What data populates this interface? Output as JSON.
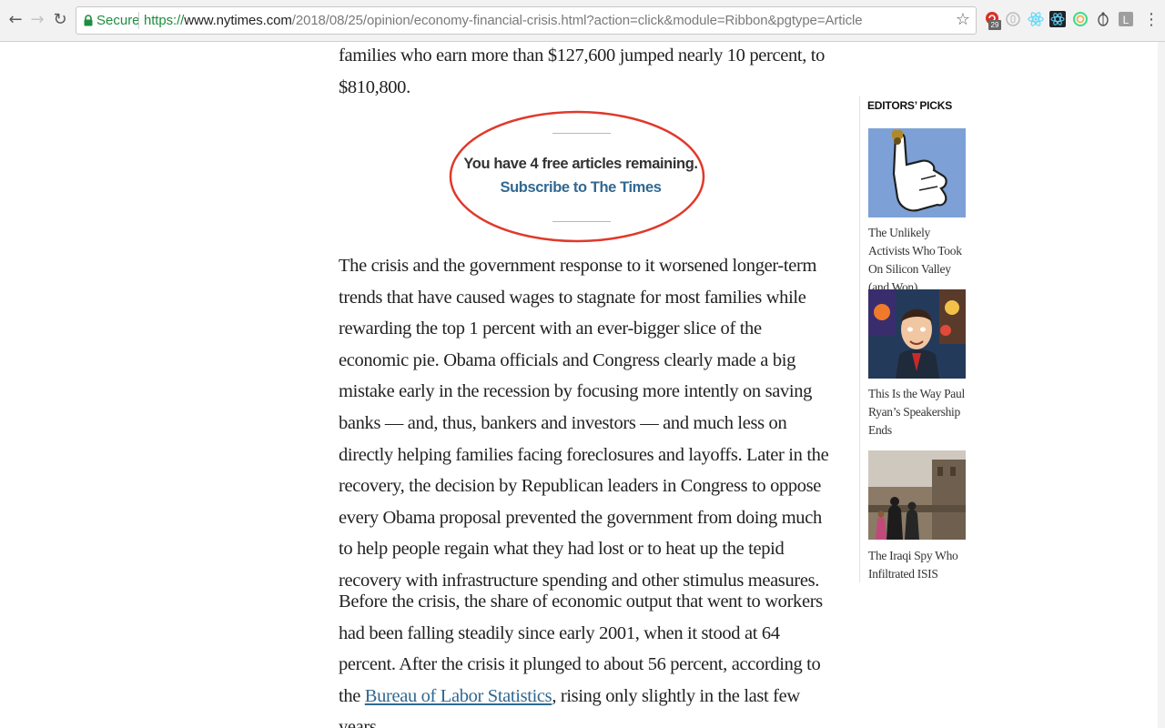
{
  "browser": {
    "secure_label": "Secure",
    "url": {
      "scheme": "https://",
      "host": "www.nytimes.com",
      "path": "/2018/08/25/opinion/economy-financial-crisis.html?action=click&module=Ribbon&pgtype=Article"
    },
    "extensions": [
      {
        "icon": "notification-extension-icon",
        "badge": "29",
        "color": "#d93025"
      },
      {
        "icon": "circle-extension-icon",
        "color": "#bbbbbb"
      },
      {
        "icon": "react-devtools-icon",
        "color": "#61dafb"
      },
      {
        "icon": "react-dark-extension-icon",
        "color": "#61dafb"
      },
      {
        "icon": "green-ring-extension-icon",
        "color": "#3ddc84"
      },
      {
        "icon": "bug-extension-icon",
        "color": "#555555"
      },
      {
        "icon": "letter-l-extension-icon",
        "letter": "L",
        "color": "#9e9e9e"
      }
    ]
  },
  "article": {
    "paragraph_top": "families who earn more than $127,600 jumped nearly 10 percent, to $810,800.",
    "paragraph_1": "The crisis and the government response to it worsened longer-term trends that have caused wages to stagnate for most families while rewarding the top 1 percent with an ever-bigger slice of the economic pie. Obama officials and Congress clearly made a big mistake early in the recession by focusing more intently on saving banks — and, thus, bankers and investors — and much less on directly helping families facing foreclosures and layoffs. Later in the recovery, the decision by Republican leaders in Congress to oppose every Obama proposal prevented the government from doing much to help people regain what they had lost or to heat up the tepid recovery with infrastructure spending and other stimulus measures.",
    "paragraph_2_before_link": "Before the crisis, the share of economic output that went to workers had been falling steadily since early 2001, when it stood at 64 percent. After the crisis it plunged to about 56 percent, according to the ",
    "paragraph_2_link": "Bureau of Labor Statistics",
    "paragraph_2_after_link": ", rising only slightly in the last few years."
  },
  "meter": {
    "remaining_text": "You have 4 free articles remaining.",
    "subscribe_label": "Subscribe to The Times",
    "annotation_color": "#e0392b"
  },
  "sidebar": {
    "title": "EDITORS’ PICKS",
    "picks": [
      {
        "title": "The Unlikely Activists Who Took On Silicon Valley (and Won)",
        "image": "thumbs-down-hand-illustration"
      },
      {
        "title": "This Is the Way Paul Ryan’s Speakership Ends",
        "image": "paul-ryan-illustration"
      },
      {
        "title": "The Iraqi Spy Who Infiltrated ISIS",
        "image": "iraqi-rooftop-photo"
      }
    ]
  }
}
